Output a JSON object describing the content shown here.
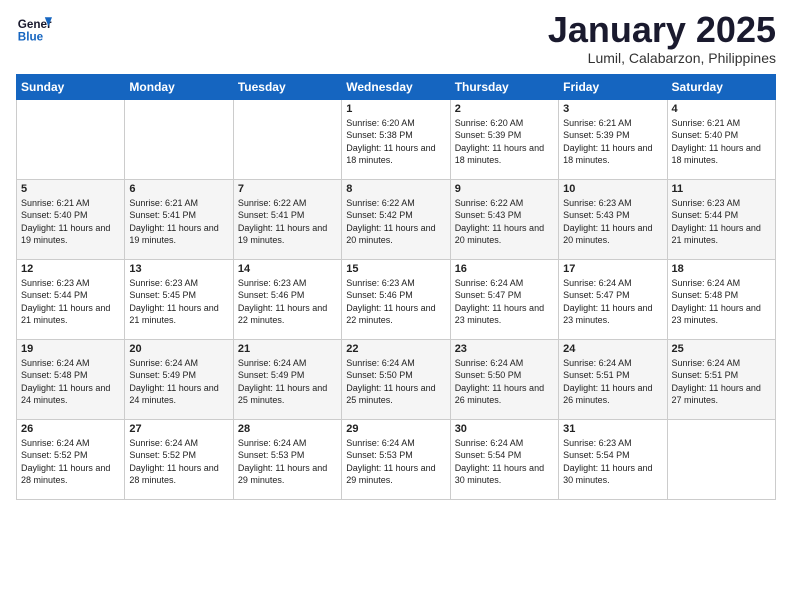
{
  "logo": {
    "general": "General",
    "blue": "Blue"
  },
  "header": {
    "title": "January 2025",
    "location": "Lumil, Calabarzon, Philippines"
  },
  "weekdays": [
    "Sunday",
    "Monday",
    "Tuesday",
    "Wednesday",
    "Thursday",
    "Friday",
    "Saturday"
  ],
  "weeks": [
    [
      {
        "day": "",
        "sunrise": "",
        "sunset": "",
        "daylight": ""
      },
      {
        "day": "",
        "sunrise": "",
        "sunset": "",
        "daylight": ""
      },
      {
        "day": "",
        "sunrise": "",
        "sunset": "",
        "daylight": ""
      },
      {
        "day": "1",
        "sunrise": "Sunrise: 6:20 AM",
        "sunset": "Sunset: 5:38 PM",
        "daylight": "Daylight: 11 hours and 18 minutes."
      },
      {
        "day": "2",
        "sunrise": "Sunrise: 6:20 AM",
        "sunset": "Sunset: 5:39 PM",
        "daylight": "Daylight: 11 hours and 18 minutes."
      },
      {
        "day": "3",
        "sunrise": "Sunrise: 6:21 AM",
        "sunset": "Sunset: 5:39 PM",
        "daylight": "Daylight: 11 hours and 18 minutes."
      },
      {
        "day": "4",
        "sunrise": "Sunrise: 6:21 AM",
        "sunset": "Sunset: 5:40 PM",
        "daylight": "Daylight: 11 hours and 18 minutes."
      }
    ],
    [
      {
        "day": "5",
        "sunrise": "Sunrise: 6:21 AM",
        "sunset": "Sunset: 5:40 PM",
        "daylight": "Daylight: 11 hours and 19 minutes."
      },
      {
        "day": "6",
        "sunrise": "Sunrise: 6:21 AM",
        "sunset": "Sunset: 5:41 PM",
        "daylight": "Daylight: 11 hours and 19 minutes."
      },
      {
        "day": "7",
        "sunrise": "Sunrise: 6:22 AM",
        "sunset": "Sunset: 5:41 PM",
        "daylight": "Daylight: 11 hours and 19 minutes."
      },
      {
        "day": "8",
        "sunrise": "Sunrise: 6:22 AM",
        "sunset": "Sunset: 5:42 PM",
        "daylight": "Daylight: 11 hours and 20 minutes."
      },
      {
        "day": "9",
        "sunrise": "Sunrise: 6:22 AM",
        "sunset": "Sunset: 5:43 PM",
        "daylight": "Daylight: 11 hours and 20 minutes."
      },
      {
        "day": "10",
        "sunrise": "Sunrise: 6:23 AM",
        "sunset": "Sunset: 5:43 PM",
        "daylight": "Daylight: 11 hours and 20 minutes."
      },
      {
        "day": "11",
        "sunrise": "Sunrise: 6:23 AM",
        "sunset": "Sunset: 5:44 PM",
        "daylight": "Daylight: 11 hours and 21 minutes."
      }
    ],
    [
      {
        "day": "12",
        "sunrise": "Sunrise: 6:23 AM",
        "sunset": "Sunset: 5:44 PM",
        "daylight": "Daylight: 11 hours and 21 minutes."
      },
      {
        "day": "13",
        "sunrise": "Sunrise: 6:23 AM",
        "sunset": "Sunset: 5:45 PM",
        "daylight": "Daylight: 11 hours and 21 minutes."
      },
      {
        "day": "14",
        "sunrise": "Sunrise: 6:23 AM",
        "sunset": "Sunset: 5:46 PM",
        "daylight": "Daylight: 11 hours and 22 minutes."
      },
      {
        "day": "15",
        "sunrise": "Sunrise: 6:23 AM",
        "sunset": "Sunset: 5:46 PM",
        "daylight": "Daylight: 11 hours and 22 minutes."
      },
      {
        "day": "16",
        "sunrise": "Sunrise: 6:24 AM",
        "sunset": "Sunset: 5:47 PM",
        "daylight": "Daylight: 11 hours and 23 minutes."
      },
      {
        "day": "17",
        "sunrise": "Sunrise: 6:24 AM",
        "sunset": "Sunset: 5:47 PM",
        "daylight": "Daylight: 11 hours and 23 minutes."
      },
      {
        "day": "18",
        "sunrise": "Sunrise: 6:24 AM",
        "sunset": "Sunset: 5:48 PM",
        "daylight": "Daylight: 11 hours and 23 minutes."
      }
    ],
    [
      {
        "day": "19",
        "sunrise": "Sunrise: 6:24 AM",
        "sunset": "Sunset: 5:48 PM",
        "daylight": "Daylight: 11 hours and 24 minutes."
      },
      {
        "day": "20",
        "sunrise": "Sunrise: 6:24 AM",
        "sunset": "Sunset: 5:49 PM",
        "daylight": "Daylight: 11 hours and 24 minutes."
      },
      {
        "day": "21",
        "sunrise": "Sunrise: 6:24 AM",
        "sunset": "Sunset: 5:49 PM",
        "daylight": "Daylight: 11 hours and 25 minutes."
      },
      {
        "day": "22",
        "sunrise": "Sunrise: 6:24 AM",
        "sunset": "Sunset: 5:50 PM",
        "daylight": "Daylight: 11 hours and 25 minutes."
      },
      {
        "day": "23",
        "sunrise": "Sunrise: 6:24 AM",
        "sunset": "Sunset: 5:50 PM",
        "daylight": "Daylight: 11 hours and 26 minutes."
      },
      {
        "day": "24",
        "sunrise": "Sunrise: 6:24 AM",
        "sunset": "Sunset: 5:51 PM",
        "daylight": "Daylight: 11 hours and 26 minutes."
      },
      {
        "day": "25",
        "sunrise": "Sunrise: 6:24 AM",
        "sunset": "Sunset: 5:51 PM",
        "daylight": "Daylight: 11 hours and 27 minutes."
      }
    ],
    [
      {
        "day": "26",
        "sunrise": "Sunrise: 6:24 AM",
        "sunset": "Sunset: 5:52 PM",
        "daylight": "Daylight: 11 hours and 28 minutes."
      },
      {
        "day": "27",
        "sunrise": "Sunrise: 6:24 AM",
        "sunset": "Sunset: 5:52 PM",
        "daylight": "Daylight: 11 hours and 28 minutes."
      },
      {
        "day": "28",
        "sunrise": "Sunrise: 6:24 AM",
        "sunset": "Sunset: 5:53 PM",
        "daylight": "Daylight: 11 hours and 29 minutes."
      },
      {
        "day": "29",
        "sunrise": "Sunrise: 6:24 AM",
        "sunset": "Sunset: 5:53 PM",
        "daylight": "Daylight: 11 hours and 29 minutes."
      },
      {
        "day": "30",
        "sunrise": "Sunrise: 6:24 AM",
        "sunset": "Sunset: 5:54 PM",
        "daylight": "Daylight: 11 hours and 30 minutes."
      },
      {
        "day": "31",
        "sunrise": "Sunrise: 6:23 AM",
        "sunset": "Sunset: 5:54 PM",
        "daylight": "Daylight: 11 hours and 30 minutes."
      },
      {
        "day": "",
        "sunrise": "",
        "sunset": "",
        "daylight": ""
      }
    ]
  ]
}
